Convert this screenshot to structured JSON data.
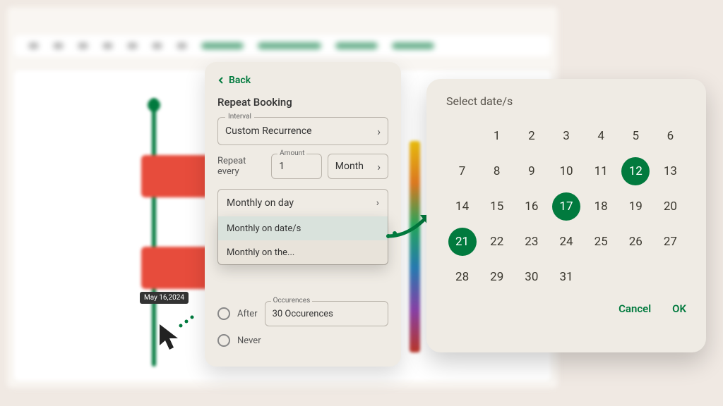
{
  "tooltip": "May 16,2024",
  "panel": {
    "back": "Back",
    "title": "Repeat Booking",
    "interval_label": "Interval",
    "interval_value": "Custom Recurrence",
    "repeat_label": "Repeat every",
    "amount_label": "Amount",
    "amount_value": "1",
    "unit_value": "Month",
    "monthly_mode": "Monthly on day",
    "dd_items": [
      "Monthly on date/s",
      "Monthly on the..."
    ],
    "after_label": "After",
    "occ_label": "Occurences",
    "occ_value": "30 Occurences",
    "never_label": "Never"
  },
  "calendar": {
    "title": "Select date/s",
    "offset": 1,
    "days": 31,
    "selected": [
      12,
      17,
      21
    ],
    "cancel": "Cancel",
    "ok": "OK"
  }
}
